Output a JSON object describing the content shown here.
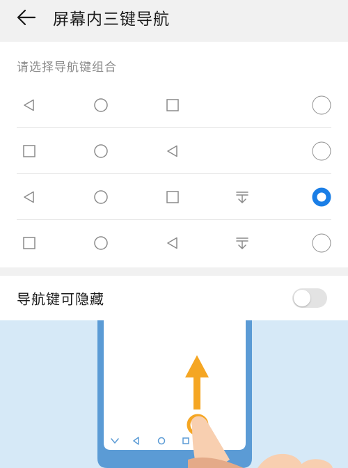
{
  "header": {
    "title": "屏幕内三键导航",
    "back_icon": "arrow-left-icon"
  },
  "selection": {
    "label": "请选择导航键组合",
    "options": [
      {
        "icons": [
          "back-triangle-icon",
          "home-circle-icon",
          "recent-square-icon"
        ],
        "selected": false
      },
      {
        "icons": [
          "recent-square-icon",
          "home-circle-icon",
          "back-triangle-icon"
        ],
        "selected": false
      },
      {
        "icons": [
          "back-triangle-icon",
          "home-circle-icon",
          "recent-square-icon",
          "notification-pulldown-icon"
        ],
        "selected": true
      },
      {
        "icons": [
          "recent-square-icon",
          "home-circle-icon",
          "back-triangle-icon",
          "notification-pulldown-icon"
        ],
        "selected": false
      }
    ]
  },
  "hide_nav": {
    "label": "导航键可隐藏",
    "enabled": false
  },
  "colors": {
    "accent": "#1a7ee6",
    "illustration_bg": "#d6e9f7",
    "phone_frame": "#5b9bd5",
    "arrow": "#f5a623"
  }
}
